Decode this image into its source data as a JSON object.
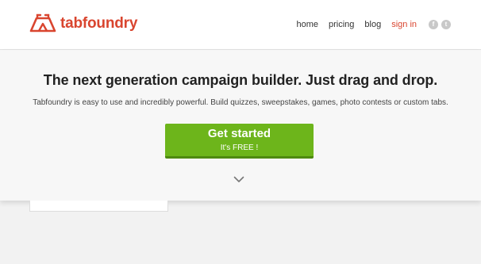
{
  "brand": {
    "name": "tabfoundry",
    "color": "#d9452f"
  },
  "nav": {
    "items": [
      {
        "label": "home",
        "name": "nav-home"
      },
      {
        "label": "pricing",
        "name": "nav-pricing"
      },
      {
        "label": "blog",
        "name": "nav-blog"
      },
      {
        "label": "sign in",
        "name": "nav-sign-in"
      }
    ],
    "social": [
      {
        "icon": "facebook-icon",
        "glyph": "f"
      },
      {
        "icon": "twitter-icon",
        "glyph": "t"
      }
    ]
  },
  "hero": {
    "headline": "The next generation campaign builder. Just drag and drop.",
    "subline": "Tabfoundry is easy to use and incredibly powerful. Build quizzes, sweepstakes, games, photo contests or custom tabs.",
    "cta": {
      "label": "Get started",
      "sublabel": "It's FREE !",
      "color": "#6db51b"
    },
    "scroll_icon": "chevron-down-icon"
  }
}
